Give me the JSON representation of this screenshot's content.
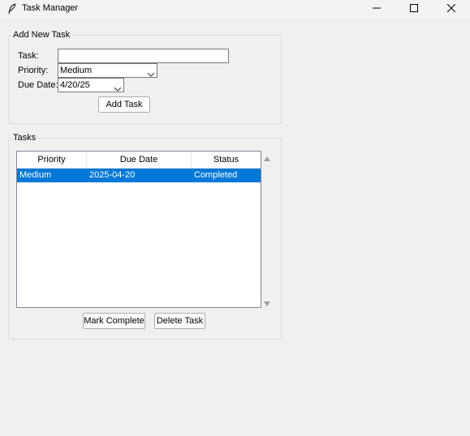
{
  "window": {
    "title": "Task Manager",
    "icon": "feather-icon",
    "controls": [
      "minimize-icon",
      "maximize-icon",
      "close-icon"
    ]
  },
  "add_task": {
    "group_label": "Add New Task",
    "task_label": "Task:",
    "task_value": "",
    "priority_label": "Priority:",
    "priority_value": "Medium",
    "due_label": "Due Date:",
    "due_value": "4/20/25",
    "add_button": "Add Task"
  },
  "tasks": {
    "group_label": "Tasks",
    "columns": [
      "Priority",
      "Due Date",
      "Status"
    ],
    "rows": [
      {
        "priority": "Medium",
        "due": "2025-04-20",
        "status": "Completed",
        "selected": true
      }
    ],
    "mark_complete_button": "Mark Complete",
    "delete_button": "Delete Task"
  },
  "colors": {
    "selection": "#0078d7",
    "background": "#f0f0f0"
  }
}
